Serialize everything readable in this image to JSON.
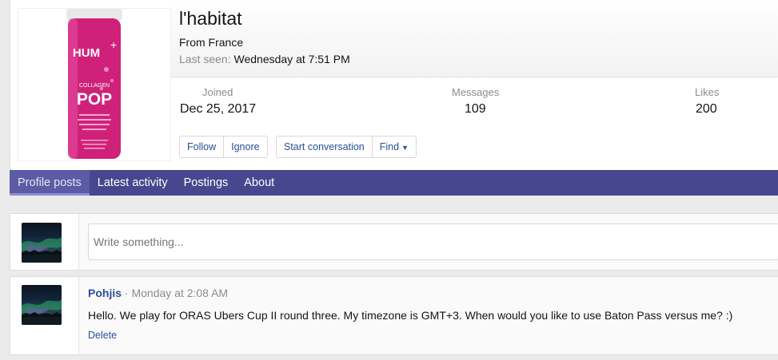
{
  "profile": {
    "username": "l'habitat",
    "location": "From France",
    "last_seen_label": "Last seen:",
    "last_seen_value": "Wednesday at 7:51 PM",
    "stats": [
      {
        "label": "Joined",
        "value": "Dec 25, 2017"
      },
      {
        "label": "Messages",
        "value": "109"
      },
      {
        "label": "Likes",
        "value": "200"
      }
    ],
    "avatar": {
      "brand": "HUM",
      "product_line": "COLLAGEN",
      "product_name": "POP",
      "colors": {
        "bottle": "#d0217a",
        "cap": "#e5e5e5"
      }
    }
  },
  "actions": {
    "follow": "Follow",
    "ignore": "Ignore",
    "start_conversation": "Start conversation",
    "find": "Find"
  },
  "tabs": [
    {
      "label": "Profile posts",
      "active": true
    },
    {
      "label": "Latest activity"
    },
    {
      "label": "Postings"
    },
    {
      "label": "About"
    }
  ],
  "composer": {
    "placeholder": "Write something..."
  },
  "posts": [
    {
      "author": "Pohjis",
      "time": "· Monday at 2:08 AM",
      "body": "Hello. We play for ORAS Ubers Cup II round three. My timezone is GMT+3. When would you like to use Baton Pass versus me? :)",
      "delete_label": "Delete"
    }
  ],
  "colors": {
    "nav": "#47478f",
    "link": "#2b4e9c",
    "muted": "#8c8c8c"
  }
}
